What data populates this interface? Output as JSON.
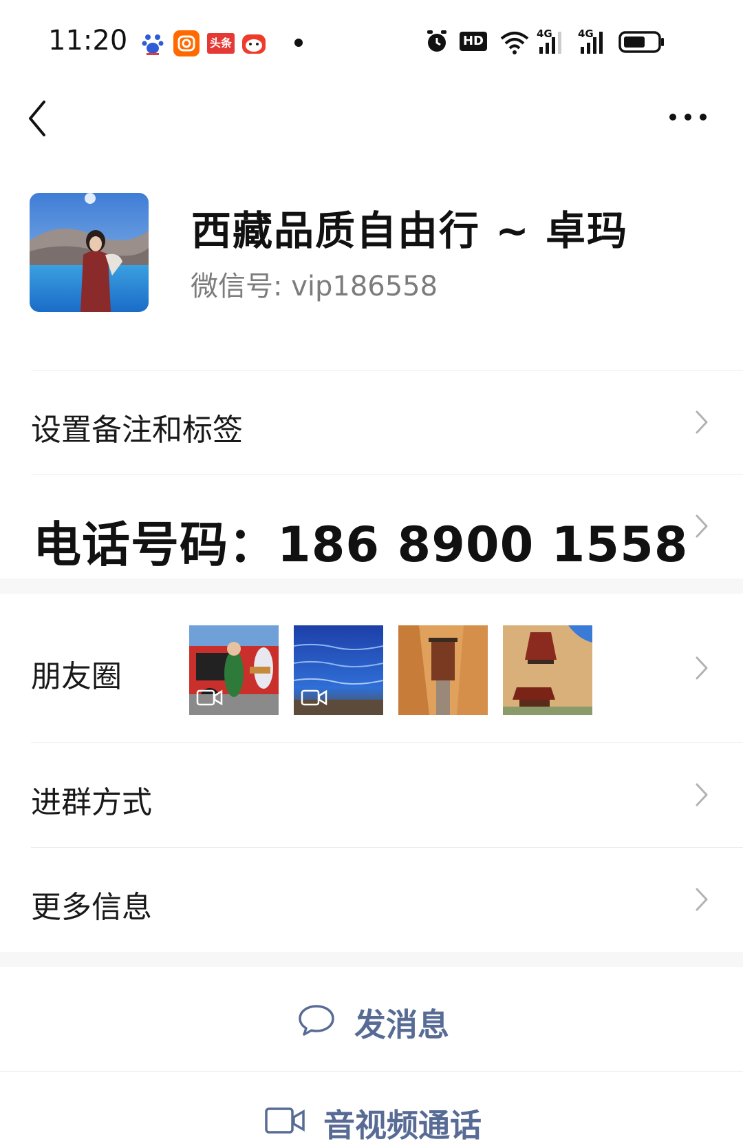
{
  "status_bar": {
    "time": "11:20",
    "left_icons": [
      "baidu-app-icon",
      "camera-app-icon",
      "toutiao-app-icon",
      "tv-app-icon"
    ],
    "toutiao_label": "头条",
    "right_icons": [
      "alarm-icon",
      "hd-icon",
      "wifi-icon",
      "signal-4g-icon",
      "signal-4g-icon",
      "battery-icon"
    ],
    "hd_label": "HD",
    "network_label": "4G"
  },
  "nav": {
    "back_icon": "chevron-left-icon",
    "more_icon": "more-dots-icon"
  },
  "profile": {
    "name": "西藏品质自由行 ~ 卓玛",
    "wechat_id": "微信号:  vip186558"
  },
  "rows": {
    "remark": "设置备注和标签",
    "phone": "电话号码：186 8900 1558",
    "moments": "朋友圈",
    "join_method": "进群方式",
    "more_info": "更多信息"
  },
  "actions": {
    "send_message": "发消息",
    "video_call": "音视频通话"
  },
  "colors": {
    "link": "#576b95",
    "divider": "#ececec",
    "gap": "#f7f7f7"
  }
}
